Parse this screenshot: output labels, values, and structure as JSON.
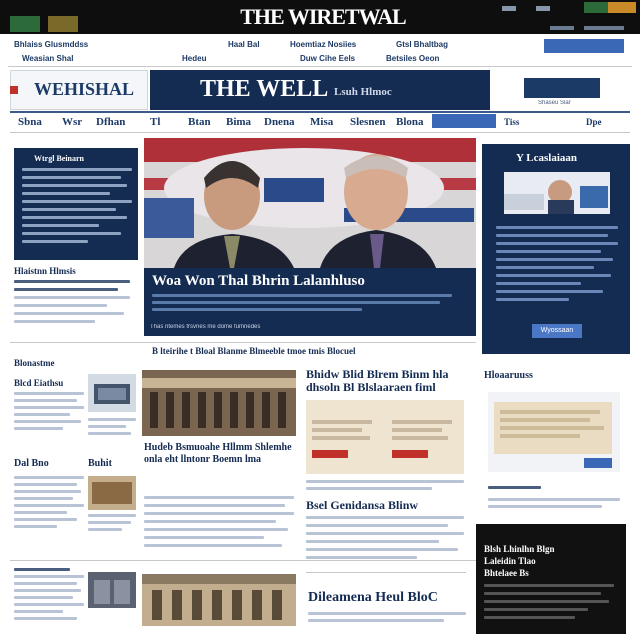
{
  "topbar": {
    "logo_text": "THE WIRETWAL",
    "left_tabs": [
      "",
      ""
    ],
    "right_links": [
      "",
      ""
    ]
  },
  "subnav": {
    "left_link": "Bhlaiss Glusmddss",
    "left_sub": "Weasian Shal",
    "center_links": [
      "Haal Bal",
      "Hoemtiaz Nosiies",
      "Gtsl Bhaltbag"
    ],
    "center_sub": [
      "Hedeu",
      "Duw Cihe Eels",
      "Betsiles Oeon"
    ]
  },
  "masthead": {
    "left_title": "WEHISHAL",
    "center_title": "THE WELL",
    "center_sub": "Lsuh Hlmoc",
    "right_label": "Shaseu Slar"
  },
  "nav": {
    "items": [
      "Sbna",
      "Wsr",
      "Dfhan",
      "Tl",
      "Btan",
      "Bima",
      "Dnena",
      "Misa",
      "Slesnen",
      "Blona"
    ],
    "right_items": [
      "Tiss",
      "Dpe"
    ],
    "search_placeholder": ""
  },
  "left_col": {
    "box_title": "Wtrgl Beinarn",
    "section": "Hlaistnn Hlmsis",
    "lines": [
      "Hel Pedaiicas Llea",
      "Hlcow Nenr Aioenr"
    ]
  },
  "lead": {
    "headline": "Woa Won Thal Bhrin Lalanhluso",
    "caption": "Thas ntemes frsvnes me dome fumnedes"
  },
  "right_col": {
    "box_title": "Y Lcaslaiaan",
    "button": "Wyossaan"
  },
  "mid": {
    "wide_headline": "B lteirihe t Bloal Blanme Blmeeble tmoe tmis Blocuel",
    "left_heads": [
      "Blonastme",
      "Blcd Eiathsu",
      "Dal Bno",
      "Buhit"
    ],
    "center_head": "Hudeb Bsmuoahe Hllmm Shlemhe onla eht llntonr Boemn lma",
    "right_head": "Bhidw Blid Blrem Binm hla dhsoln Bl Blslaaraen fiml",
    "right_head2": "Bsel Genidansa Blinw",
    "bottom_head": "Dileamena Heul BloC",
    "right_small": "Hloaaruuss",
    "dark_box_title": "Blsh Lhinlhn Blgn",
    "dark_box_lines": [
      "Laleidin Tlao",
      "Bhtelaee Bs"
    ]
  },
  "colors": {
    "navy": "#142b52",
    "accent": "#4a78c6",
    "red": "#c0312a"
  }
}
